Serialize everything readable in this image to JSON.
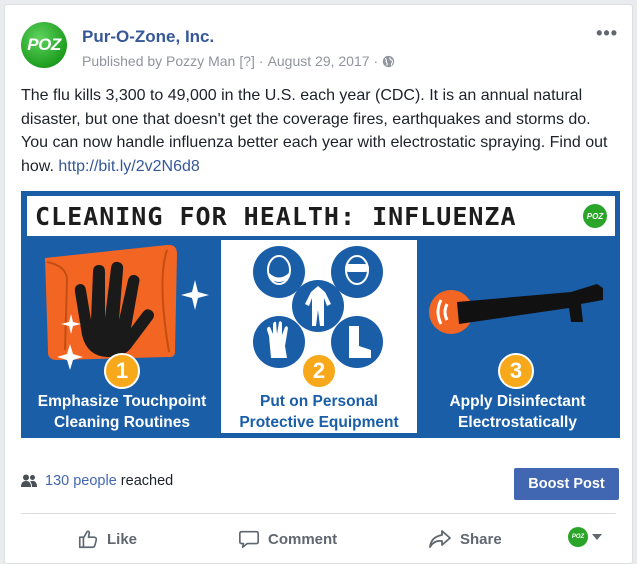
{
  "post": {
    "avatar_text": "POZ",
    "page_name": "Pur-O-Zone, Inc.",
    "published_by": "Published by Pozzy Man",
    "help_marker": "[?]",
    "sep1": "·",
    "date": "August 29, 2017",
    "sep2": "·",
    "more_label": "•••",
    "text": "The flu kills 3,300 to 49,000 in the U.S. each year (CDC). It is an annual natural disaster, but one that doesn't get the coverage fires, earthquakes and storms do. You can now handle influenza better each year with electrostatic spraying. Find out how. ",
    "link": "http://bit.ly/2v2N6d8"
  },
  "banner": {
    "title": "CLEANING FOR HEALTH:  INFLUENZA",
    "logo_text": "POZ",
    "steps": [
      {
        "num": "1",
        "line1": "Emphasize Touchpoint",
        "line2": "Cleaning Routines"
      },
      {
        "num": "2",
        "line1": "Put on Personal",
        "line2": "Protective Equipment"
      },
      {
        "num": "3",
        "line1": "Apply Disinfectant",
        "line2": "Electrostatically"
      }
    ],
    "colors": {
      "blue": "#1a5ea8",
      "orange": "#f26522",
      "gold": "#f7a81b",
      "lightblue": "#1e7fc6"
    }
  },
  "stats": {
    "count": "130 people",
    "suffix": "reached",
    "boost_label": "Boost Post"
  },
  "actions": {
    "like": "Like",
    "comment": "Comment",
    "share": "Share",
    "audience_logo": "POZ"
  },
  "colors": {
    "link": "#365899",
    "button": "#4267b2",
    "meta": "#90949c"
  }
}
